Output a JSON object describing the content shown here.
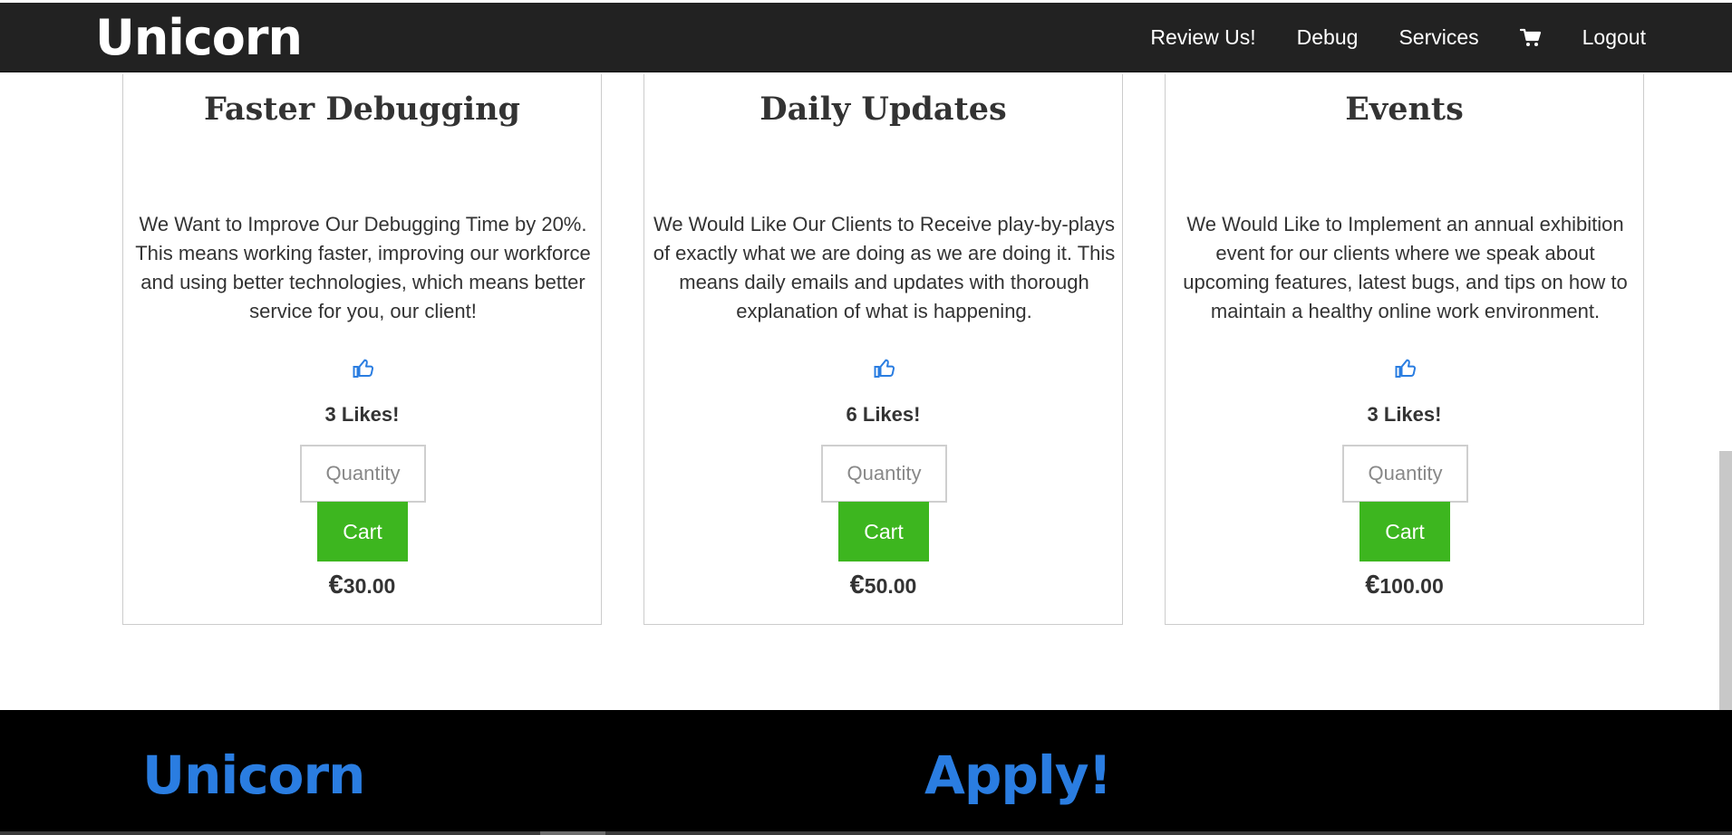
{
  "navbar": {
    "brand": "Unicorn",
    "links": {
      "review": "Review Us!",
      "debug": "Debug",
      "services": "Services",
      "logout": "Logout"
    },
    "cart_icon": "shopping-cart-icon"
  },
  "services": [
    {
      "title": "Faster Debugging",
      "description": "We Want to Improve Our Debugging Time by 20%. This means working faster, improving our workforce and using better technologies, which means better service for you, our client!",
      "like_icon": "thumbs-up-icon",
      "likes": "3 Likes!",
      "quantity_placeholder": "Quantity",
      "cart_label": "Cart",
      "currency": "€",
      "price": "30.00"
    },
    {
      "title": "Daily Updates",
      "description": "We Would Like Our Clients to Receive play-by-plays of exactly what we are doing as we are doing it. This means daily emails and updates with thorough explanation of what is happening.",
      "like_icon": "thumbs-up-icon",
      "likes": "6 Likes!",
      "quantity_placeholder": "Quantity",
      "cart_label": "Cart",
      "currency": "€",
      "price": "50.00"
    },
    {
      "title": "Events",
      "description": "We Would Like to Implement an annual exhibition event for our clients where we speak about upcoming features, latest bugs, and tips on how to maintain a healthy online work environment.",
      "like_icon": "thumbs-up-icon",
      "likes": "3 Likes!",
      "quantity_placeholder": "Quantity",
      "cart_label": "Cart",
      "currency": "€",
      "price": "100.00"
    }
  ],
  "footer": {
    "brand": "Unicorn",
    "apply": "Apply!"
  },
  "colors": {
    "navbar_bg": "#222222",
    "cart_button": "#3db61f",
    "footer_bg": "#000000",
    "footer_text": "#2a7de1",
    "like_icon": "#2a7de1"
  }
}
